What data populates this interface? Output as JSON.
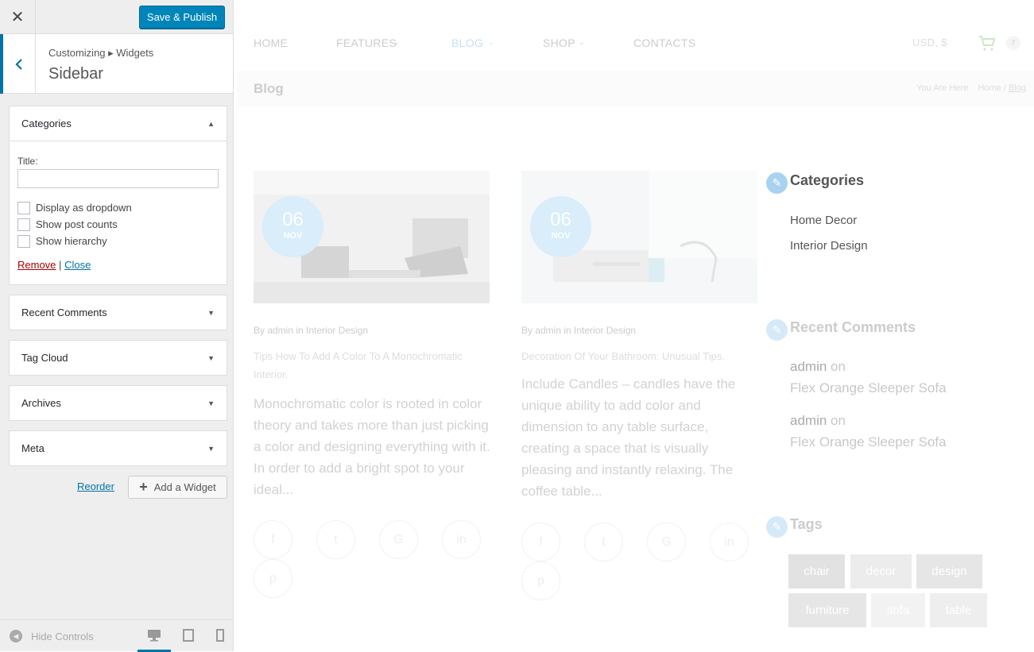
{
  "panel": {
    "close_icon": "close-icon",
    "publish_label": "Save & Publish",
    "breadcrumb": "Customizing ▸ Widgets",
    "title": "Sidebar",
    "widgets": [
      {
        "label": "Categories",
        "expanded": true
      },
      {
        "label": "Recent Comments",
        "expanded": false
      },
      {
        "label": "Tag Cloud",
        "expanded": false
      },
      {
        "label": "Archives",
        "expanded": false
      },
      {
        "label": "Meta",
        "expanded": false
      }
    ],
    "categories_form": {
      "title_label": "Title:",
      "title_value": "",
      "checkboxes": [
        "Display as dropdown",
        "Show post counts",
        "Show hierarchy"
      ],
      "remove_label": "Remove",
      "separator": "|",
      "close_label": "Close"
    },
    "reorder_label": "Reorder",
    "add_widget_label": "Add a Widget",
    "hide_controls_label": "Hide Controls",
    "accent_color": "#0073aa",
    "publish_color": "#0085ba"
  },
  "preview": {
    "nav": [
      "HOME",
      "FEATURES",
      "BLOG",
      "SHOP",
      "CONTACTS"
    ],
    "currency": "USD, $",
    "cart_count": "7",
    "page_title": "Blog",
    "breadcrumb": {
      "you_are_here": "You Are Here",
      "home": "Home",
      "sep": "/",
      "current": "Blog"
    },
    "posts": [
      {
        "day": "06",
        "month": "NOV",
        "meta": "By admin  in Interior Design",
        "title": "Tips How To Add A Color To A Monochromatic Interior.",
        "excerpt": "Monochromatic color is rooted in color theory and takes more than just picking a color and designing everything with it. In order to add a bright spot to your ideal..."
      },
      {
        "day": "06",
        "month": "NOV",
        "meta": "By admin  in Interior Design",
        "title": "Decoration Of Your Bathroom: Unusual Tips.",
        "excerpt": "Include Candles – candles have the unique ability to add color and dimension to any table surface, creating a space that is visually pleasing and instantly relaxing. The coffee table..."
      }
    ],
    "sidebar": {
      "categories_title": "Categories",
      "categories": [
        "Home Decor",
        "Interior Design"
      ],
      "recent_comments_title": "Recent Comments",
      "comments": [
        {
          "author": "admin",
          "on": "on",
          "post": "Flex Orange Sleeper Sofa"
        },
        {
          "author": "admin",
          "on": "on",
          "post": "Flex Orange Sleeper Sofa"
        }
      ],
      "tags_title": "Tags",
      "tags": [
        "chair",
        "decor",
        "design",
        "furniture",
        "sofa",
        "table"
      ]
    }
  }
}
